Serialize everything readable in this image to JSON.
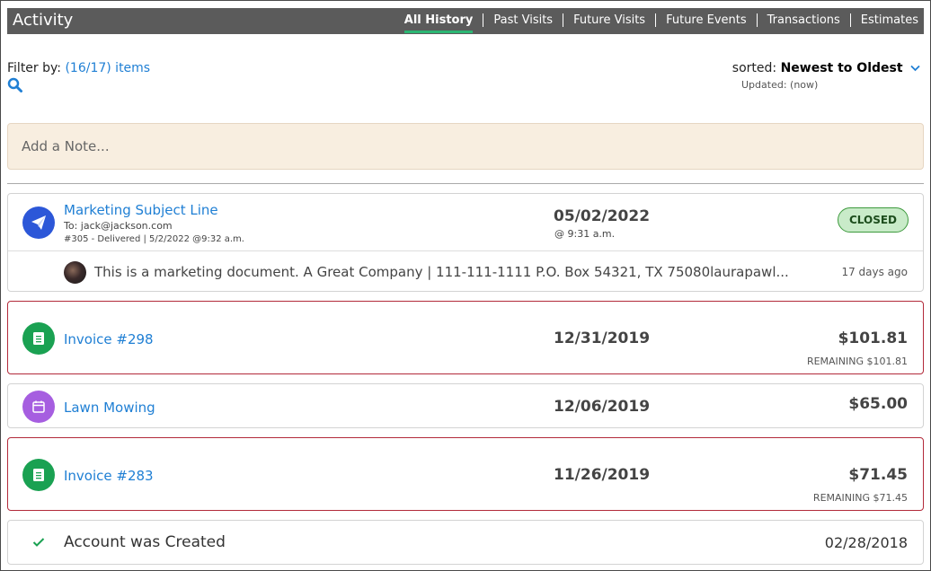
{
  "header": {
    "title": "Activity",
    "tabs": [
      {
        "label": "All History",
        "active": true
      },
      {
        "label": "Past Visits"
      },
      {
        "label": "Future Visits"
      },
      {
        "label": "Future Events"
      },
      {
        "label": "Transactions"
      },
      {
        "label": "Estimates"
      }
    ]
  },
  "filter": {
    "label": "Filter by:",
    "link": "(16/17) items"
  },
  "sort": {
    "label": "sorted:",
    "value": "Newest to Oldest",
    "updated": "Updated: (now)"
  },
  "note": {
    "placeholder": "Add a Note..."
  },
  "items": [
    {
      "icon": "paper-plane-icon",
      "title": "Marketing Subject Line",
      "to": "To: jack@jackson.com",
      "meta": "#305 - Delivered | 5/2/2022 @9:32 a.m.",
      "date": "05/02/2022",
      "time": "@ 9:31 a.m.",
      "badge": "CLOSED",
      "message": "This is a marketing document. A Great Company | 111-111-1111 P.O. Box 54321, TX 75080laurapawl...",
      "message_age": "17 days ago"
    },
    {
      "icon": "invoice-icon",
      "title": "Invoice #298",
      "date": "12/31/2019",
      "amount": "$101.81",
      "remaining": "REMAINING $101.81"
    },
    {
      "icon": "calendar-icon",
      "title": "Lawn Mowing",
      "date": "12/06/2019",
      "amount": "$65.00"
    },
    {
      "icon": "invoice-icon",
      "title": "Invoice #283",
      "date": "11/26/2019",
      "amount": "$71.45",
      "remaining": "REMAINING $71.45"
    },
    {
      "icon": "checkmark-icon",
      "title": "Account was Created",
      "date": "02/28/2018"
    }
  ],
  "colors": {
    "header_bg": "#5b5b5b",
    "active_tab_underline": "#2bb673",
    "link": "#1f7fd4",
    "note_bg": "#f8eee0",
    "alert_border": "#b22a3a",
    "badge_bg": "#c9ebc9"
  }
}
